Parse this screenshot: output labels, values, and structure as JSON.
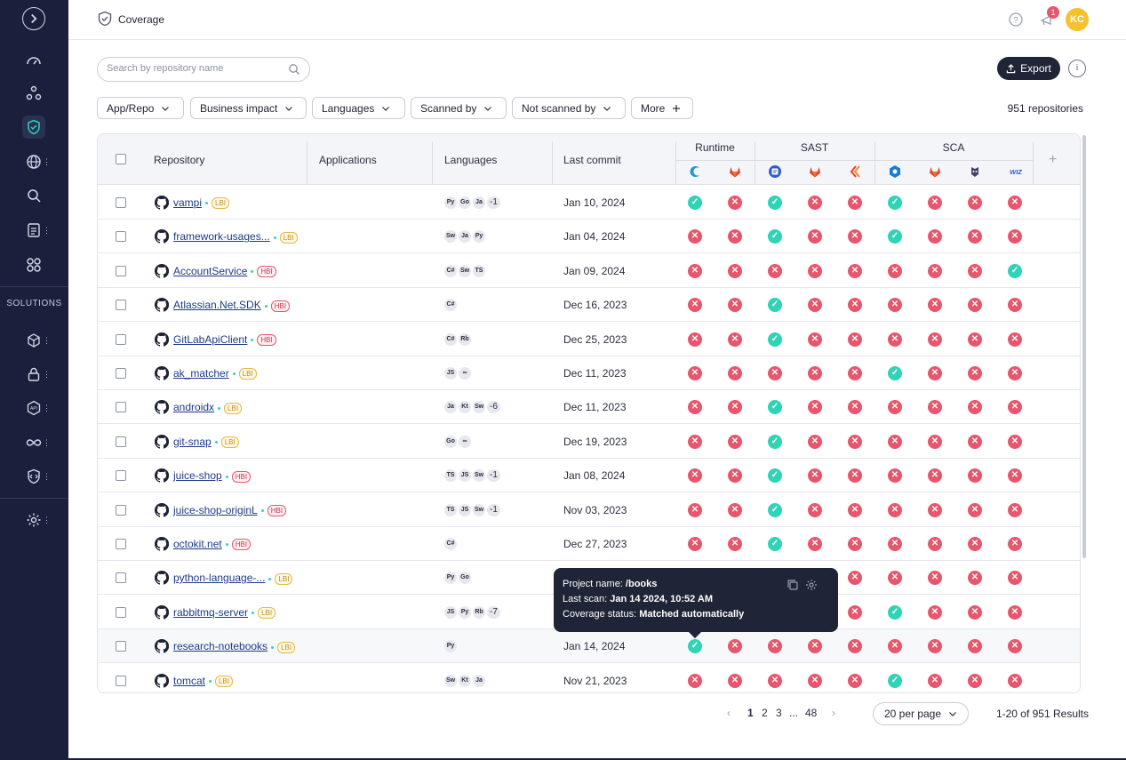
{
  "sidebar": {
    "items": [
      {
        "name": "expand-icon"
      },
      {
        "name": "dashboard-icon"
      },
      {
        "name": "graph-icon"
      },
      {
        "name": "shield-check-icon"
      },
      {
        "name": "globe-icon"
      },
      {
        "name": "search-scan-icon"
      },
      {
        "name": "report-icon"
      },
      {
        "name": "integrations-icon"
      },
      {
        "name": "cube-icon"
      },
      {
        "name": "lock-icon"
      },
      {
        "name": "api-icon"
      },
      {
        "name": "infinity-icon"
      },
      {
        "name": "code-shield-icon"
      },
      {
        "name": "gear-icon"
      }
    ],
    "solutions_label": "SOLUTIONS"
  },
  "header": {
    "title": "Coverage",
    "notification_count": "1",
    "avatar_initials": "KC"
  },
  "search": {
    "placeholder": "Search by repository name"
  },
  "export_label": "Export",
  "filters": [
    "App/Repo",
    "Business impact",
    "Languages",
    "Scanned by",
    "Not scanned by",
    "More"
  ],
  "repo_count": "951 repositories",
  "table": {
    "headers": {
      "repository": "Repository",
      "applications": "Applications",
      "languages": "Languages",
      "last_commit": "Last commit"
    },
    "groups": [
      "Runtime",
      "SAST",
      "SCA"
    ],
    "tools": [
      "runtime-tool-icon",
      "gitlab-icon",
      "sast-tool-icon",
      "gitlab-icon",
      "checkmarx-icon",
      "sca-tool-icon",
      "gitlab-icon",
      "snyk-icon",
      "wiz-icon"
    ],
    "rows": [
      {
        "name": "vampi",
        "impact": "LBI",
        "langs": [
          "Py",
          "Go",
          "Ja"
        ],
        "more": "-1",
        "commit": "Jan 10, 2024",
        "status": [
          1,
          0,
          1,
          0,
          0,
          1,
          0,
          0,
          0
        ]
      },
      {
        "name": "framework-usages...",
        "impact": "LBI",
        "langs": [
          "Sw",
          "Ja",
          "Py"
        ],
        "more": "",
        "commit": "Jan 04, 2024",
        "status": [
          0,
          0,
          1,
          0,
          0,
          1,
          0,
          0,
          0
        ]
      },
      {
        "name": "AccountService",
        "impact": "HBI",
        "langs": [
          "C#",
          "Sw",
          "TS"
        ],
        "more": "",
        "commit": "Jan 09, 2024",
        "status": [
          0,
          0,
          0,
          0,
          0,
          0,
          0,
          0,
          1
        ]
      },
      {
        "name": "Atlassian.Net.SDK",
        "impact": "HBI",
        "langs": [
          "C#"
        ],
        "more": "",
        "commit": "Dec 16, 2023",
        "status": [
          0,
          0,
          1,
          0,
          0,
          0,
          0,
          0,
          0
        ]
      },
      {
        "name": "GitLabApiClient",
        "impact": "HBI",
        "langs": [
          "C#",
          "Rb"
        ],
        "more": "",
        "commit": "Dec 25, 2023",
        "status": [
          0,
          0,
          1,
          0,
          0,
          0,
          0,
          0,
          0
        ]
      },
      {
        "name": "ak_matcher",
        "impact": "LBI",
        "langs": [
          "JS",
          "∞"
        ],
        "more": "",
        "commit": "Dec 11, 2023",
        "status": [
          0,
          0,
          0,
          0,
          0,
          1,
          0,
          0,
          0
        ]
      },
      {
        "name": "androidx",
        "impact": "LBI",
        "langs": [
          "Ja",
          "Kt",
          "Sw"
        ],
        "more": "-6",
        "commit": "Dec 11, 2023",
        "status": [
          0,
          0,
          1,
          0,
          0,
          0,
          0,
          0,
          0
        ]
      },
      {
        "name": "git-snap",
        "impact": "LBI",
        "langs": [
          "Go",
          "∞"
        ],
        "more": "",
        "commit": "Dec 19, 2023",
        "status": [
          0,
          0,
          1,
          0,
          0,
          0,
          0,
          0,
          0
        ]
      },
      {
        "name": "juice-shop",
        "impact": "HBI",
        "langs": [
          "TS",
          "JS",
          "Sw"
        ],
        "more": "-1",
        "commit": "Jan 08, 2024",
        "status": [
          0,
          0,
          1,
          0,
          0,
          0,
          0,
          0,
          0
        ]
      },
      {
        "name": "juice-shop-originL",
        "impact": "HBI",
        "langs": [
          "TS",
          "JS",
          "Sw"
        ],
        "more": "-1",
        "commit": "Nov 03, 2023",
        "status": [
          0,
          0,
          1,
          0,
          0,
          0,
          0,
          0,
          0
        ]
      },
      {
        "name": "octokit.net",
        "impact": "HBI",
        "langs": [
          "C#"
        ],
        "more": "",
        "commit": "Dec 27, 2023",
        "status": [
          0,
          0,
          1,
          0,
          0,
          0,
          0,
          0,
          0
        ]
      },
      {
        "name": "python-language-...",
        "impact": "LBI",
        "langs": [
          "Py",
          "Go"
        ],
        "more": "",
        "commit": "",
        "status": [
          null,
          null,
          null,
          null,
          0,
          0,
          0,
          0,
          0
        ]
      },
      {
        "name": "rabbitmq-server",
        "impact": "LBI",
        "langs": [
          "JS",
          "Py",
          "Rb"
        ],
        "more": "-7",
        "commit": "",
        "status": [
          null,
          null,
          null,
          null,
          0,
          1,
          0,
          0,
          0
        ]
      },
      {
        "name": "research-notebooks",
        "impact": "LBI",
        "langs": [
          "Py"
        ],
        "more": "",
        "commit": "Jan 14, 2024",
        "status": [
          1,
          0,
          0,
          0,
          0,
          0,
          0,
          0,
          0
        ]
      },
      {
        "name": "tomcat",
        "impact": "LBI",
        "langs": [
          "Sw",
          "Kt",
          "Ja"
        ],
        "more": "",
        "commit": "Nov 21, 2023",
        "status": [
          0,
          0,
          0,
          0,
          0,
          1,
          0,
          0,
          0
        ]
      }
    ]
  },
  "tooltip": {
    "project_label": "Project name: ",
    "project_value": "/books",
    "scan_label": "Last scan: ",
    "scan_value": "Jan 14 2024, 10:52 AM",
    "coverage_label": "Coverage status: ",
    "coverage_value": "Matched automatically"
  },
  "pagination": {
    "prev": "‹",
    "pages": [
      "1",
      "2",
      "3",
      "...",
      "48"
    ],
    "next": "›",
    "per_page": "20 per page",
    "results": "1-20 of 951 Results"
  },
  "colors": {
    "ok": "#2fd3b5",
    "fail": "#e8566c",
    "sidebar": "#1b1f3b",
    "accent": "#2fd3b5"
  }
}
